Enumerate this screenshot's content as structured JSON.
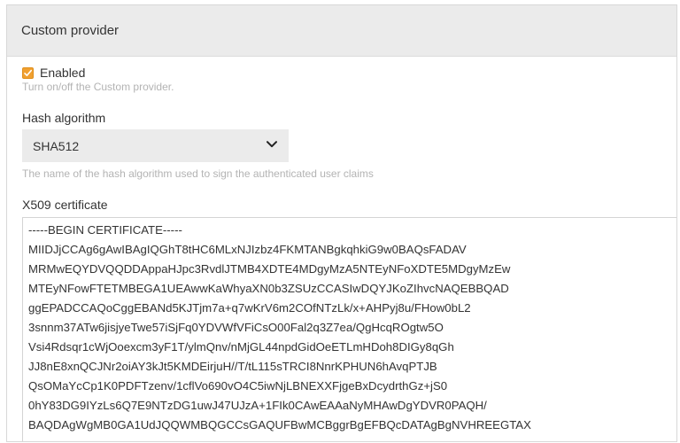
{
  "panel": {
    "title": "Custom provider"
  },
  "enabled": {
    "label": "Enabled",
    "checked": true,
    "help": "Turn on/off the Custom provider."
  },
  "hash": {
    "label": "Hash algorithm",
    "value": "SHA512",
    "help": "The name of the hash algorithm used to sign the authenticated user claims"
  },
  "certificate": {
    "label": "X509 certificate",
    "lines": [
      "-----BEGIN CERTIFICATE-----",
      "MIIDJjCCAg6gAwIBAgIQGhT8tHC6MLxNJIzbz4FKMTANBgkqhkiG9w0BAQsFADAV",
      "MRMwEQYDVQQDDAppaHJpc3RvdlJTMB4XDTE4MDgyMzA5NTEyNFoXDTE5MDgyMzEw",
      "MTEyNFowFTETMBEGA1UEAwwKaWhyaXN0b3ZSUzCCASIwDQYJKoZIhvcNAQEBBQAD",
      "ggEPADCCAQoCggEBANd5KJTjm7a+q7wKrV6m2COfNTzLk/x+AHPyj8u/FHow0bL2",
      "3snnm37ATw6jisjyeTwe57iSjFq0YDVWfVFiCsO00Fal2q3Z7ea/QgHcqROgtw5O",
      "Vsi4Rdsqr1cWjOoexcm3yF1T/ylmQnv/nMjGL44npdGidOeETLmHDoh8DIGy8qGh",
      "JJ8nE8xnQCJNr2oiAY3kJt5KMDEirjuH//T/tL115sTRCI8NnrKPHUN6hAvqPTJB",
      "QsOMaYcCp1K0PDFTzenv/1cflVo690vO4C5iwNjLBNEXXFjgeBxDcydrthGz+jS0",
      "0hY83DG9IYzLs6Q7E9NTzDG1uwJ47UJzA+1FIk0CAwEAAaNyMHAwDgYDVR0PAQH/",
      "BAQDAgWgMB0GA1UdJQQWMBQGCCsGAQUFBwMCBggrBgEFBQcDATAgBgNVHREEGTAX"
    ]
  },
  "colors": {
    "checkbox": "#f0a030",
    "header_bg": "#ebebeb",
    "help_text": "#b3b3b3"
  },
  "icons": {
    "checkbox": "check-icon",
    "select": "chevron-down-icon"
  }
}
